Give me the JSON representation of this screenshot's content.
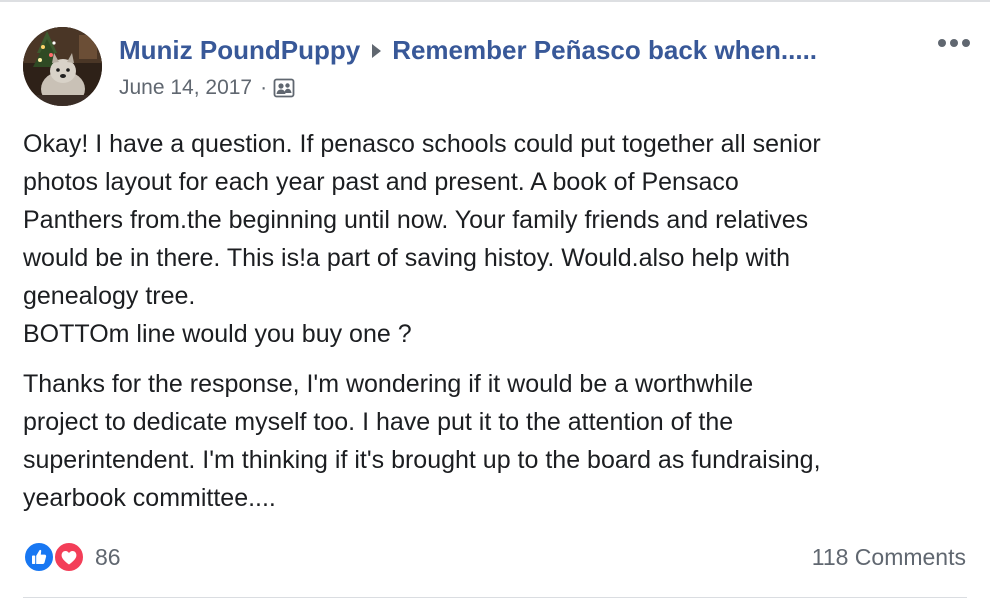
{
  "post": {
    "author": "Muniz PoundPuppy",
    "group": "Remember Peñasco back when.....",
    "date": "June 14, 2017",
    "separator": "·",
    "privacy_icon": "group-members-icon",
    "more_icon": "more-options-icon",
    "paragraphs": [
      {
        "lines": [
          "Okay! I have a question. If penasco schools could put together all senior",
          "photos layout for each year past and present. A book of Pensaco",
          "Panthers from.the beginning until now. Your family friends and relatives",
          "would be in there. This is!a part of saving histoy. Would.also help with",
          "genealogy tree.",
          "BOTTOm line would you buy one ?"
        ]
      },
      {
        "lines": [
          "Thanks for the response, I'm wondering if it would be a worthwhile",
          "project to dedicate myself too. I have put it to the attention of the",
          "superintendent. I'm thinking if it's brought up to the board as fundraising,",
          "yearbook committee...."
        ]
      }
    ]
  },
  "footer": {
    "reaction_icons": [
      "like-icon",
      "love-icon"
    ],
    "reaction_count": "86",
    "comments": "118 Comments"
  },
  "colors": {
    "link": "#385898",
    "meta": "#606770",
    "text": "#1c1e21",
    "like": "#1877f2",
    "love": "#f33e58"
  }
}
